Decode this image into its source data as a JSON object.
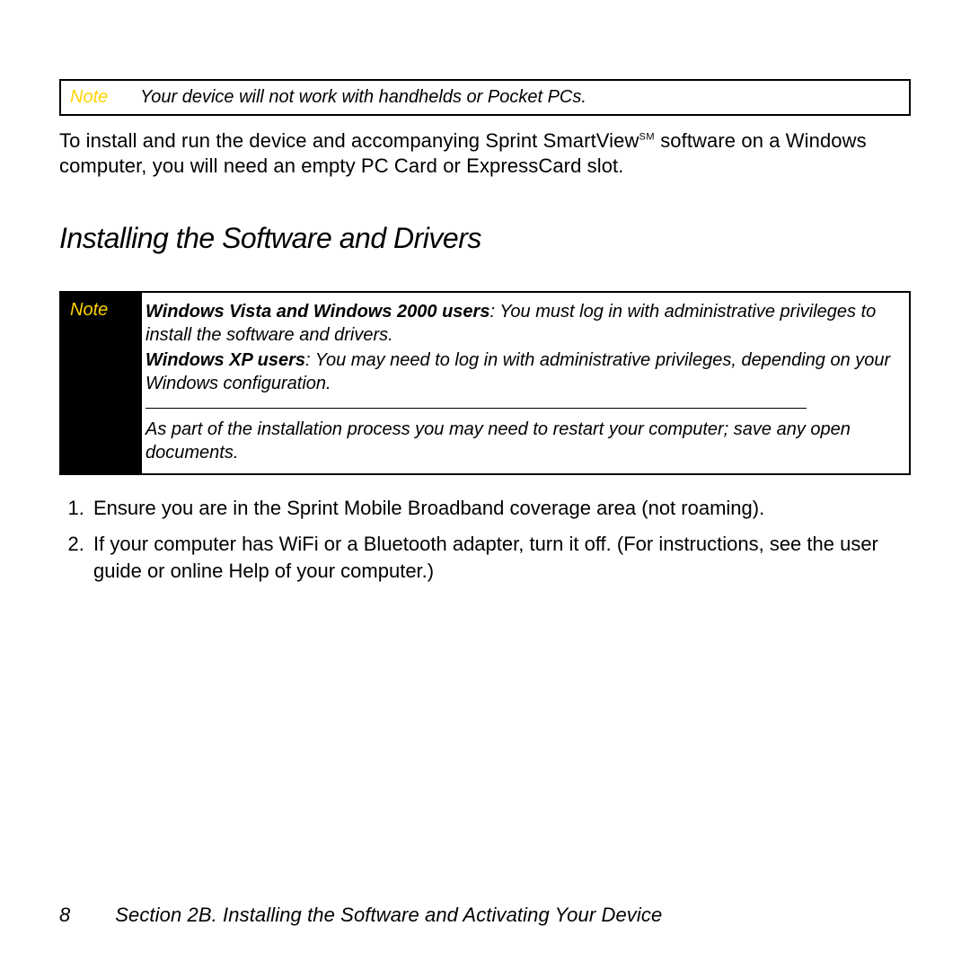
{
  "note1": {
    "label": "Note",
    "text": "Your device will not work with handhelds or Pocket PCs."
  },
  "intro": {
    "pre": "To install and run the device and accompanying Sprint SmartView",
    "sm": "SM",
    "post": " software on a Windows computer, you will need an empty PC Card or ExpressCard slot."
  },
  "section_title": "Installing the Software and Drivers",
  "note2": {
    "label": "Note",
    "p1_bold": "Windows Vista and Windows 2000 users",
    "p1_rest": ": You must log in with administrative privileges to install the software and drivers.",
    "p2_bold": "Windows XP users",
    "p2_rest": ": You may need to log in with administrative privileges, depending on your Windows configuration.",
    "p3": "As part of the installation process you may need to restart your computer; save any open documents."
  },
  "steps": {
    "s1": "Ensure you are in the Sprint Mobile Broadband coverage area (not roaming).",
    "s2": "If your computer has WiFi or a Bluetooth adapter, turn it off. (For instructions, see the user guide or online Help of your computer.)"
  },
  "footer": {
    "page": "8",
    "text": "Section 2B. Installing the Software and Activating Your Device"
  }
}
